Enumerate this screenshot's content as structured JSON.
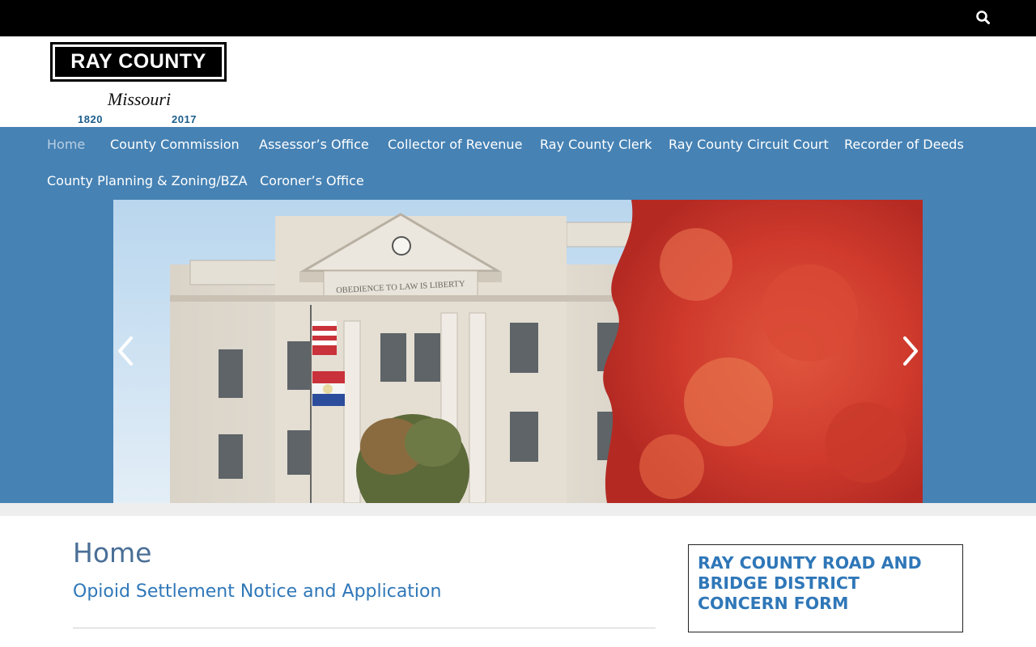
{
  "topbar": {
    "search_icon": "search-icon"
  },
  "logo": {
    "name": "RAY COUNTY",
    "state": "Missouri",
    "year_start": "1820",
    "year_end": "2017"
  },
  "nav": {
    "items": [
      {
        "label": "Home",
        "active": true
      },
      {
        "label": "County Commission"
      },
      {
        "label": "Assessor’s Office"
      },
      {
        "label": "Collector of Revenue"
      },
      {
        "label": "Ray County Clerk"
      },
      {
        "label": "Ray County Circuit Court"
      },
      {
        "label": "Recorder of Deeds"
      },
      {
        "label": "County Planning & Zoning/BZA"
      },
      {
        "label": "Coroner’s Office"
      }
    ]
  },
  "slider": {
    "inscription": "OBEDIENCE TO LAW IS LIBERTY",
    "prev_icon": "chevron-left-icon",
    "next_icon": "chevron-right-icon"
  },
  "main": {
    "title": "Home",
    "post_title": "Opioid Settlement Notice and Application"
  },
  "sidebar": {
    "widget_title": "RAY COUNTY ROAD AND BRIDGE DISTRICT CONCERN FORM"
  },
  "colors": {
    "nav_bg": "#4682b4",
    "accent_blue": "#2f77b8",
    "title_blue": "#4a6f96"
  }
}
